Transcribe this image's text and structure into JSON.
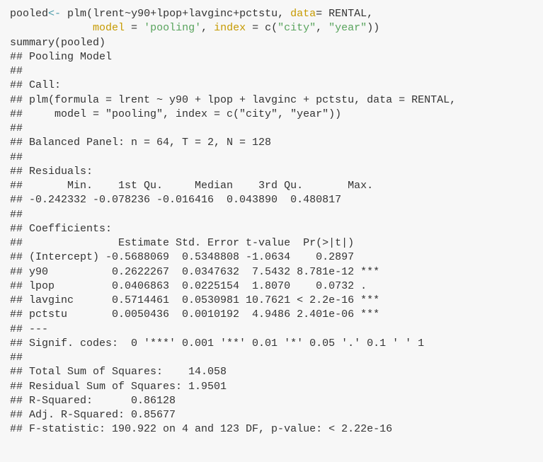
{
  "code": {
    "l1": {
      "obj": "pooled",
      "assign": "<-",
      "fn": "plm",
      "open": "(",
      "formula": "lrent~y90+lpop+lavginc+pctstu, ",
      "dataArg": "data",
      "eq1": "= ",
      "dataset": "RENTAL",
      "comma1": ","
    },
    "l2": {
      "pad": "             ",
      "modelArg": "model",
      "eq2": " = ",
      "modelStr": "'pooling'",
      "comma2": ", ",
      "indexArg": "index",
      "eq3": " = ",
      "cfn": "c(",
      "idx1": "\"city\"",
      "comma3": ", ",
      "idx2": "\"year\"",
      "close": "))"
    },
    "l3": "summary(pooled)"
  },
  "out": {
    "l01": "",
    "l02": "## Pooling Model",
    "l03": "## ",
    "l04": "## Call:",
    "l05": "## plm(formula = lrent ~ y90 + lpop + lavginc + pctstu, data = RENTAL, ",
    "l06": "##     model = \"pooling\", index = c(\"city\", \"year\"))",
    "l07": "## ",
    "l08": "## Balanced Panel: n = 64, T = 2, N = 128",
    "l09": "## ",
    "l10": "## Residuals:",
    "l11": "##       Min.    1st Qu.     Median    3rd Qu.       Max. ",
    "l12": "## -0.242332 -0.078236 -0.016416  0.043890  0.480817 ",
    "l13": "## ",
    "l14": "## Coefficients:",
    "l15": "##               Estimate Std. Error t-value  Pr(>|t|)    ",
    "l16": "## (Intercept) -0.5688069  0.5348808 -1.0634    0.2897    ",
    "l17": "## y90          0.2622267  0.0347632  7.5432 8.781e-12 ***",
    "l18": "## lpop         0.0406863  0.0225154  1.8070    0.0732 .  ",
    "l19": "## lavginc      0.5714461  0.0530981 10.7621 < 2.2e-16 ***",
    "l20": "## pctstu       0.0050436  0.0010192  4.9486 2.401e-06 ***",
    "l21": "## ---",
    "l22": "## Signif. codes:  0 '***' 0.001 '**' 0.01 '*' 0.05 '.' 0.1 ' ' 1",
    "l23": "## ",
    "l24": "## Total Sum of Squares:    14.058",
    "l25": "## Residual Sum of Squares: 1.9501",
    "l26": "## R-Squared:      0.86128",
    "l27": "## Adj. R-Squared: 0.85677",
    "l28": "## F-statistic: 190.922 on 4 and 123 DF, p-value: < 2.22e-16"
  }
}
